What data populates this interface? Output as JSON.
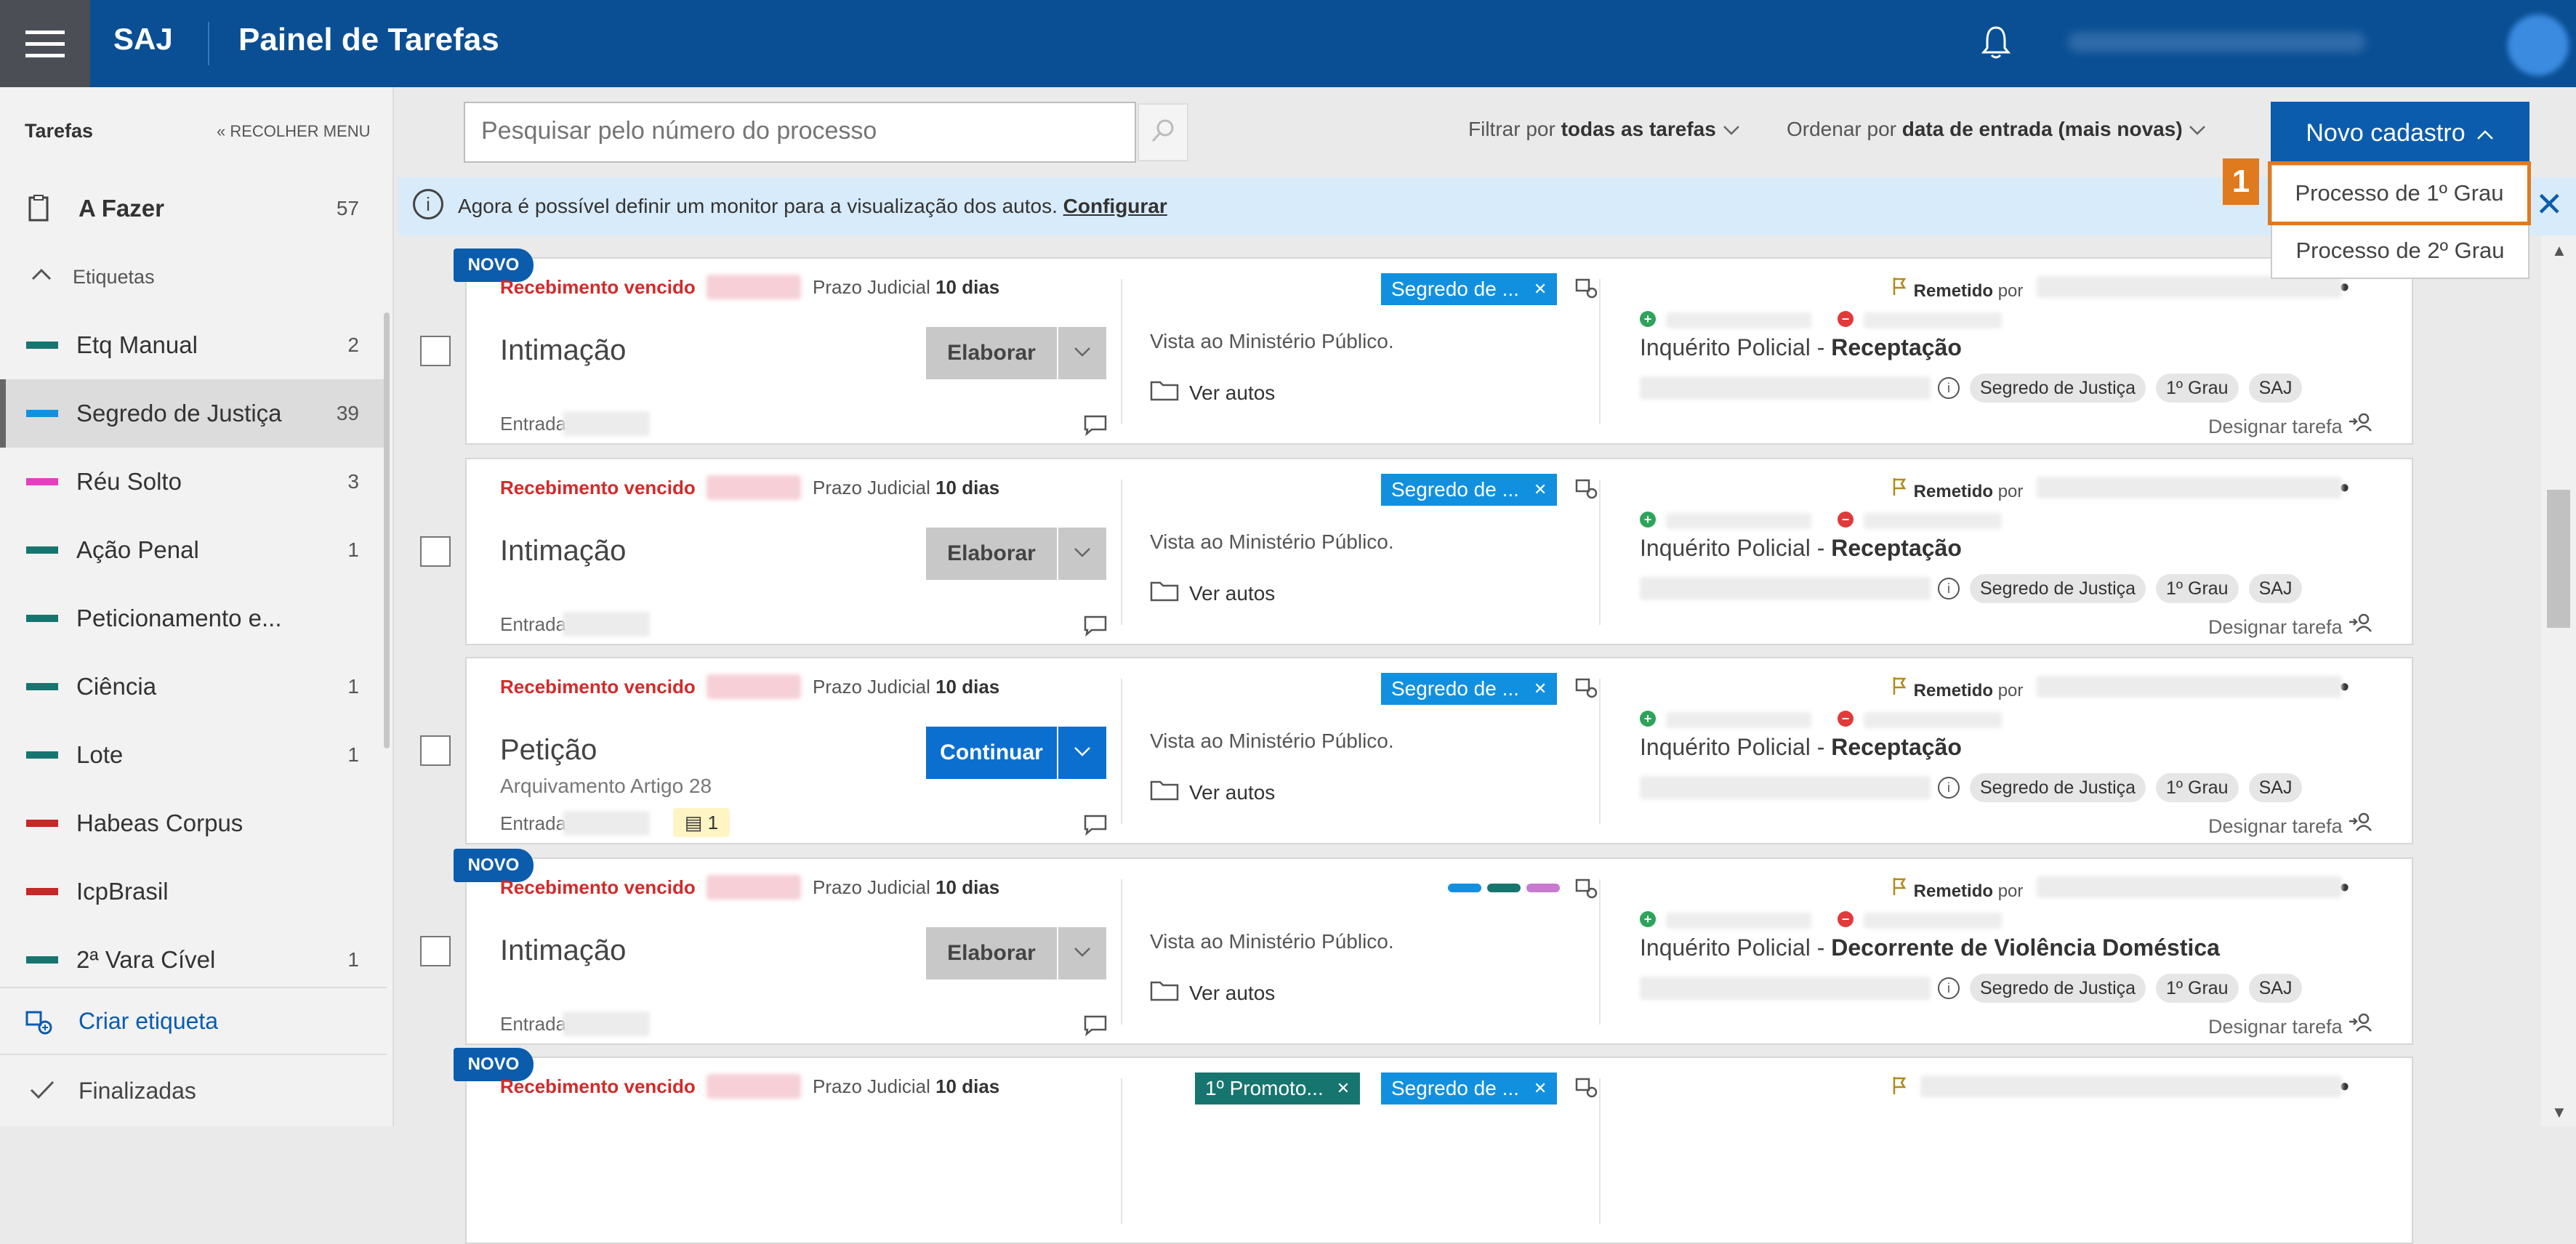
{
  "header": {
    "brand": "SAJ",
    "title": "Painel de Tarefas"
  },
  "sidebar": {
    "title": "Tarefas",
    "collapse_label": "« RECOLHER MENU",
    "afazer": {
      "label": "A Fazer",
      "count": "57"
    },
    "etiquetas_label": "Etiquetas",
    "items": [
      {
        "label": "Etq Manual",
        "count": "2",
        "color": "#17756f"
      },
      {
        "label": "Segredo de Justiça",
        "count": "39",
        "color": "#1290e0"
      },
      {
        "label": "Réu Solto",
        "count": "3",
        "color": "#e83ebf"
      },
      {
        "label": "Ação Penal",
        "count": "1",
        "color": "#17756f"
      },
      {
        "label": "Peticionamento e...",
        "count": "",
        "color": "#17756f"
      },
      {
        "label": "Ciência",
        "count": "1",
        "color": "#17756f"
      },
      {
        "label": "Lote",
        "count": "1",
        "color": "#17756f"
      },
      {
        "label": "Habeas Corpus",
        "count": "",
        "color": "#c62828"
      },
      {
        "label": "IcpBrasil",
        "count": "",
        "color": "#c62828"
      },
      {
        "label": "2ª Vara Cível",
        "count": "1",
        "color": "#17756f"
      }
    ],
    "criar_label": "Criar etiqueta",
    "finalizadas_label": "Finalizadas"
  },
  "toolbar": {
    "search_placeholder": "Pesquisar pelo número do processo",
    "filter_prefix": "Filtrar por ",
    "filter_value": "todas as tarefas",
    "order_prefix": "Ordenar por ",
    "order_value": "data de entrada (mais novas)",
    "new_label": "Novo cadastro",
    "dropdown": [
      "Processo de 1º Grau",
      "Processo de 2º Grau"
    ],
    "step_badge": "1"
  },
  "info": {
    "text": "Agora é possível definir um monitor para a visualização dos autos. ",
    "link": "Configurar"
  },
  "common": {
    "novo": "NOVO",
    "rec_vencido": "Recebimento vencido",
    "prazo_prefix": "Prazo Judicial ",
    "prazo_value": "10 dias",
    "entrada": "Entrada",
    "vista": "Vista ao Ministério Público.",
    "ver_autos": "Ver autos",
    "remetido": "Remetido",
    "por": " por",
    "inq_prefix": "Inquérito Policial - ",
    "chip_segredo": "Segredo de Justiça",
    "chip_grau": "1º Grau",
    "chip_saj": "SAJ",
    "designar": "Designar tarefa",
    "tag_segredo": "Segredo de ...",
    "tag_promoto": "1º Promoto...",
    "btn_elaborar": "Elaborar",
    "btn_continuar": "Continuar"
  },
  "cards": [
    {
      "type": "Intimação",
      "subject": "Receptação",
      "novo": true,
      "button": "Elaborar",
      "sub": ""
    },
    {
      "type": "Intimação",
      "subject": "Receptação",
      "novo": false,
      "button": "Elaborar",
      "sub": ""
    },
    {
      "type": "Petição",
      "subject": "Receptação",
      "novo": false,
      "button": "Continuar",
      "sub": "Arquivamento Artigo 28",
      "badge": "1"
    },
    {
      "type": "Intimação",
      "subject": "Decorrente de Violência Doméstica",
      "novo": true,
      "button": "Elaborar",
      "sub": ""
    }
  ],
  "colors": {
    "header": "#0a4f94",
    "accent": "#0b5cad",
    "highlight": "#e07a1e",
    "danger": "#d32a2a"
  }
}
